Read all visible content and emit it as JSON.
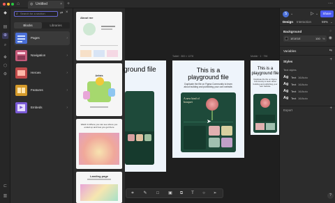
{
  "titlebar": {
    "tab_label": "Untitled"
  },
  "left_panel": {
    "search_placeholder": "Search for a section",
    "tabs": [
      "Blocks",
      "Libraries"
    ],
    "categories": [
      {
        "label": "Pages",
        "color": "#4a6fd6"
      },
      {
        "label": "Navigation",
        "color": "#c55a7a"
      },
      {
        "label": "Heroes",
        "color": "#c04a4a"
      },
      {
        "label": "Features",
        "color": "#d49a2a"
      },
      {
        "label": "Embeds",
        "color": "#7a5ad6"
      }
    ]
  },
  "templates": {
    "t1_title": "About me",
    "t2_title": "Artists",
    "t3_text": "Watch & Where you can see where you ended up and how you got there",
    "t4_title": "Landing page"
  },
  "canvas": {
    "frame_tablet_label": "Tablet · 800 × 1278",
    "frame_mobile_label": "Mobile · 1 · 796",
    "hero_partial_title": "ground file",
    "hero_title_line1": "This is a",
    "hero_title_line2": "playground file",
    "hero_sub": "Duplicate the file on Figma Community to learn about building and publishing your own website.",
    "card_title": "A new kind of bouquet",
    "mobile_title_line1": "This is a",
    "mobile_title_line2": "playground file",
    "mobile_sub": "Duplicate the file on Figma Community to learn about building and publishing your own website."
  },
  "toolbar": {
    "tools": [
      "frame-tool-icon",
      "pen-tool-icon",
      "shape-tool-icon",
      "image-tool-icon",
      "component-tool-icon",
      "text-tool-icon",
      "comment-tool-icon",
      "send-icon"
    ]
  },
  "right_panel": {
    "avatar_initial": "S",
    "share_label": "Share",
    "tabs": [
      "Design",
      "Interaction"
    ],
    "zoom": "59%",
    "background_label": "Background",
    "color_hex": "1E1E1E",
    "opacity": "100",
    "variables_label": "Variables",
    "styles_label": "Styles",
    "text_styles_label": "Text styles",
    "text_styles": [
      {
        "sample": "Ag",
        "name": "Text",
        "meta": "16/Auto"
      },
      {
        "sample": "Ag",
        "name": "Text",
        "meta": "16/Auto"
      },
      {
        "sample": "Ag",
        "name": "Text",
        "meta": "16/Auto"
      },
      {
        "sample": "Ag",
        "name": "Text",
        "meta": "16/Auto"
      }
    ],
    "export_label": "Export",
    "help": "?"
  }
}
